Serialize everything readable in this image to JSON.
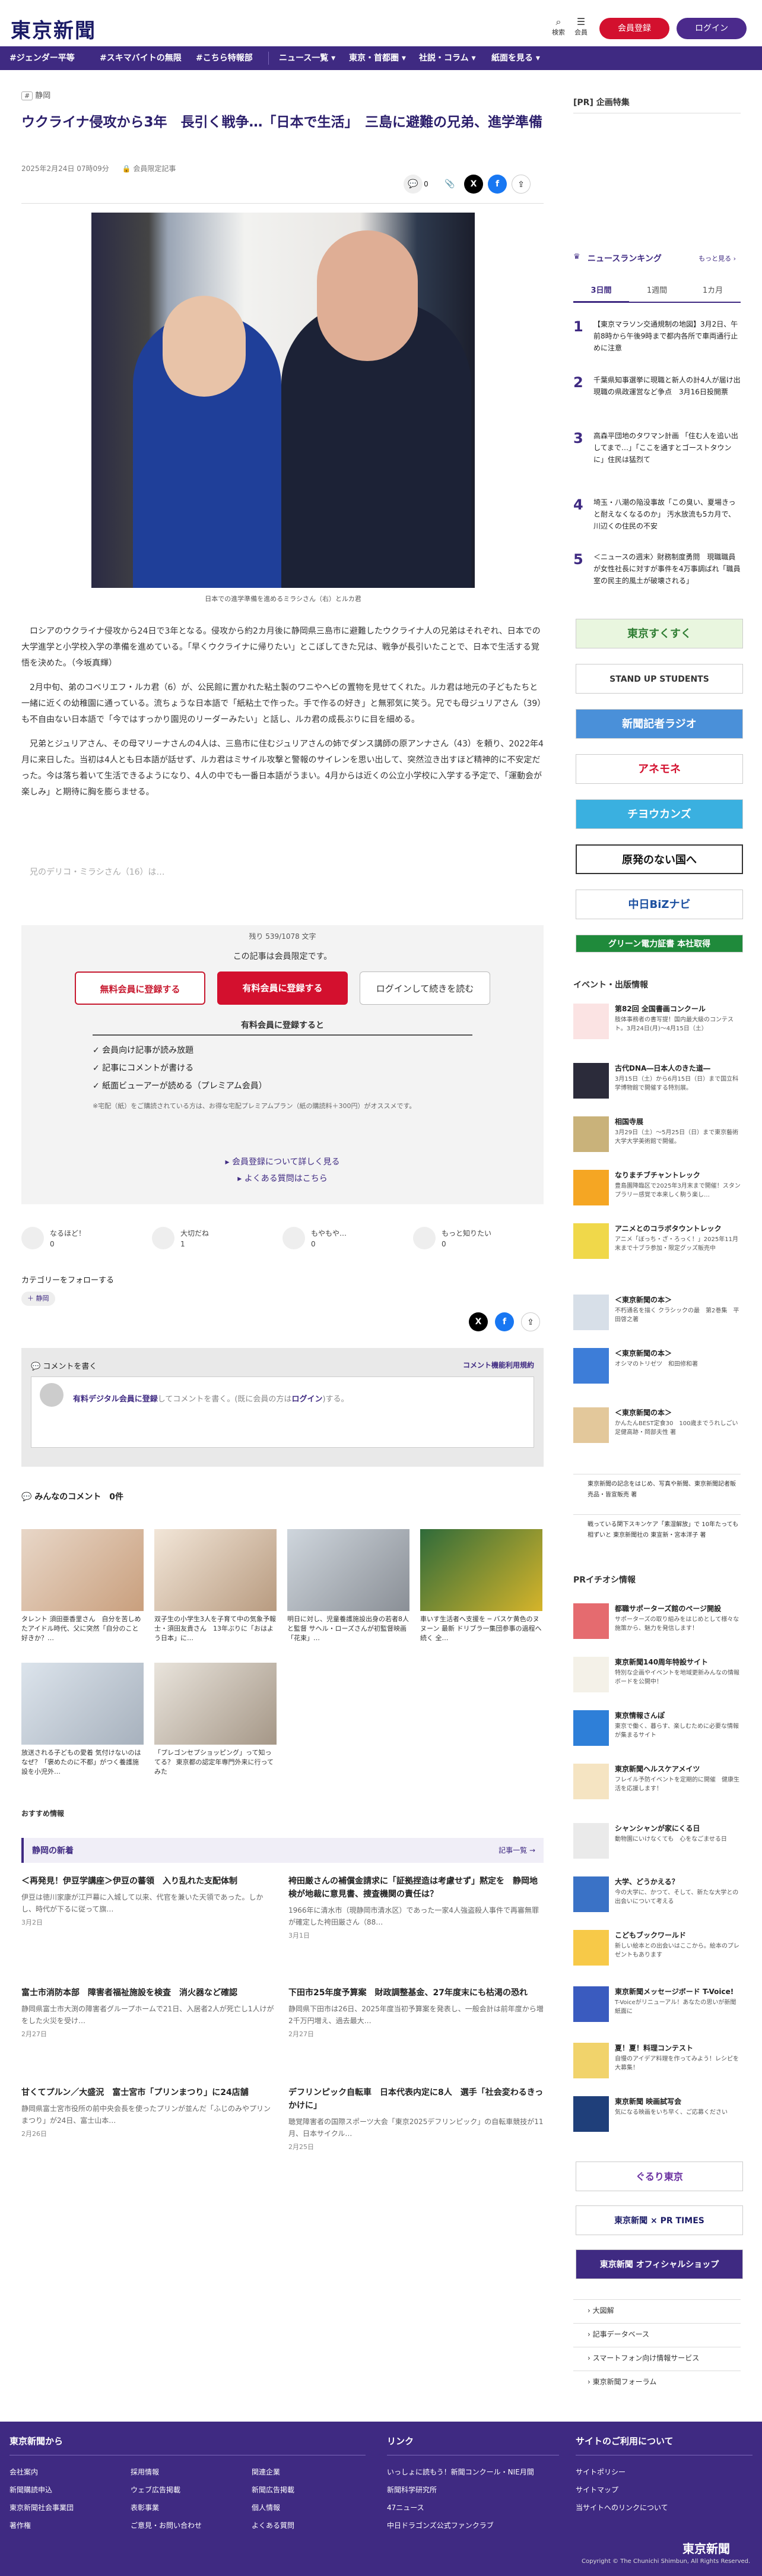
{
  "header": {
    "logo": "東京新聞",
    "search_label": "検索",
    "menu_label": "会員",
    "register_label": "会員登録",
    "login_label": "ログイン"
  },
  "nav": [
    "#ジェンダー平等",
    "#スキマバイトの無限",
    "#こちら特報部",
    "ニュース一覧 ▾",
    "東京・首都圏 ▾",
    "社説・コラム ▾",
    "紙面を見る ▾"
  ],
  "article": {
    "kicker": "静岡",
    "title": "ウクライナ侵攻から3年　長引く戦争…「日本で生活」　三島に避難の兄弟、進学準備",
    "date": "2025年2月24日 07時09分",
    "member_only": "会員限定記事",
    "comment_count": "0",
    "caption": "日本での進学準備を進めるミラシさん（右）とルカ君",
    "paragraphs": [
      "ロシアのウクライナ侵攻から24日で3年となる。侵攻から約2カ月後に静岡県三島市に避難したウクライナ人の兄弟はそれぞれ、日本での大学進学と小学校入学の準備を進めている。「早くウクライナに帰りたい」とこぼしてきた兄は、戦争が長引いたことで、日本で生活する覚悟を決めた。（今坂真輝）",
      "2月中旬、弟のコベリエフ・ルカ君（6）が、公民館に置かれた粘土製のワニやヘビの置物を見せてくれた。ルカ君は地元の子どもたちと一緒に近くの幼稚園に通っている。流ちょうな日本語で「紙粘土で作った。手で作るの好き」と無邪気に笑う。兄でも母ジュリアさん（39）も不自由ない日本語で「今ではすっかり園児のリーダーみたい」と話し、ルカ君の成長ぶりに目を細める。",
      "兄弟とジュリアさん、その母マリーナさんの4人は、三島市に住むジュリアさんの姉でダンス講師の原アンナさん（43）を頼り、2022年4月に来日した。当初は4人とも日本語が話せず、ルカ君はミサイル攻撃と警報のサイレンを思い出して、突然泣き出すほど精神的に不安定だった。今は落ち着いて生活できるようになり、4人の中でも一番日本語がうまい。4月からは近くの公立小学校に入学する予定で、「運動会が楽しみ」と期待に胸を膨らませる。"
    ],
    "fade_text": "兄のデリコ・ミラシさん（16）は…"
  },
  "paywall": {
    "count": "残り 539/1078 文字",
    "only": "この記事は会員限定です。",
    "free_btn": "無料会員に登録する",
    "paid_btn": "有料会員に登録する",
    "login_btn": "ログインして続きを読む",
    "benefit_head": "有料会員に登録すると",
    "benefits": [
      "✓ 会員向け記事が読み放題",
      "✓ 記事にコメントが書ける",
      "✓ 紙面ビューアーが読める（プレミアム会員）"
    ],
    "note": "※宅配（紙）をご購読されている方は、お得な宅配プレミアムプラン（紙の購読料＋300円）がオススメです。",
    "link1": "▸ 会員登録について詳しく見る",
    "link2": "▸ よくある質問はこちら"
  },
  "reactions": [
    {
      "label": "なるほど！",
      "count": "0"
    },
    {
      "label": "大切だね",
      "count": "1"
    },
    {
      "label": "もやもや…",
      "count": "0"
    },
    {
      "label": "もっと知りたい",
      "count": "0"
    }
  ],
  "follow": {
    "label": "カテゴリーをフォローする",
    "chip": "＋ 静岡"
  },
  "comments": {
    "head": "コメントを書く",
    "rules": "コメント機能利用規約",
    "prompt_link": "有料デジタル会員に登録",
    "prompt_text": "してコメントを書く。(既に会員の方は",
    "prompt_login": "ログイン",
    "prompt_end": ")する。",
    "all": "みんなのコメント　0件"
  },
  "recommend": [
    {
      "title": "タレント 須田亜香里さん　自分を苦しめたアイドル時代、父に突然「自分のこと好きか？…"
    },
    {
      "title": "双子生の小学生3人を子育て中の気象予報士・須田友貴さん　13年ぶりに「おはよう日本」に…"
    },
    {
      "title": "明日に対し、児童養護施設出身の若者8人と監督 サヘル・ローズさんが初監督映画「花束」…"
    },
    {
      "title": "車いす生活者へ支援を ─ バスケ黄色のヌヌーン  最新 ドリブラ一集団参事の過程へ続く 全…"
    },
    {
      "title": "放送される子どもの愛着 気付けないのはなぜ？「褒めたのに不都」がつく養護施設を小児外…"
    },
    {
      "title": "「プレゴンセプショッピング」って知ってる？ 東京都の認定年専門外来に行ってみた"
    }
  ],
  "recommend_label": "おすすめ情報",
  "local": {
    "head": "静岡の新着",
    "more": "記事一覧 →",
    "items": [
      {
        "title": "＜再発見！伊豆学講座＞伊豆の蕃領　入り乱れた支配体制",
        "desc": "伊豆は徳川家康が江戸幕に入城して以来、代官を兼いた天領であった。しかし、時代が下るに従って旗…",
        "date": "3月2日"
      },
      {
        "title": "袴田厳さんの補償金請求に「証拠捏造は考慮せず」黙定を　静岡地検が地裁に意見書、捜査機関の責任は？",
        "desc": "1966年に清水市（現静岡市清水区）であった一家4人強盗殺人事件で再審無罪が確定した袴田厳さん（88…",
        "date": "3月1日"
      },
      {
        "title": "富士市消防本部　障害者福祉施設を検査　消火器など確認",
        "desc": "静岡県富士市大渕の障害者グループホームで21日、入居者2人が死亡し1人けがをした火災を受け…",
        "date": "2月27日"
      },
      {
        "title": "下田市25年度予算案　財政調整基金、27年度末にも枯渇の恐れ",
        "desc": "静岡県下田市は26日、2025年度当初予算案を発表し、一般会計は前年度から増2千万円増え、過去最大…",
        "date": "2月27日"
      },
      {
        "title": "甘くてプルン／大盛況　富士宮市「プリンまつり」に24店舗",
        "desc": "静岡県富士宮市役所の前中央会長を使ったプリンが並んだ「ふじのみやプリンまつり」が24日、富士山本…",
        "date": "2月26日"
      },
      {
        "title": "デフリンピック自転車　日本代表内定に8人　選手「社会変わるきっかけに」",
        "desc": "聴覚障害者の国際スポーツ大会「東京2025デフリンピック」の自転車競技が11月、日本サイクル…",
        "date": "2月25日"
      }
    ]
  },
  "sidebar": {
    "pr": "[PR] 企画特集",
    "ranking_head": "ニュースランキング",
    "ranking_more": "もっと見る ›",
    "tabs": [
      "3日間",
      "1週間",
      "1カ月"
    ],
    "ranking": [
      "【東京マラソン交通規制の地図】3月2日、午前8時から午後9時まで都内各所で車両通行止めに注意",
      "千葉県知事選挙に現職と新人の計4人が届け出　現職の県政運営など争点　3月16日投開票",
      "高森平団地のタワマン計画 「住む人を追い出してまで…」「ここを通すとゴーストタウンに」住民は猛烈て",
      "埼玉・八潮の陥没事故「この臭い、夏場きっと耐えなくなるのか」 汚水放流も5カ月で、川辺くの住民の不安",
      "＜ニュースの週末〉財務制度勇問　現職職員が女性社長に対すが事件を4万事調ばれ「職員室の民主的風土が破壊される」"
    ],
    "banners": [
      "東京すくすく",
      "STAND UP STUDENTS",
      "新聞記者ラジオ",
      "アネモネ",
      "チヨウカンズ",
      "原発のない国へ",
      "中日BiZナビ",
      "グリーン電力証書 本社取得"
    ],
    "events_head": "イベント・出版情報",
    "events": [
      {
        "title": "第82回 全国書画コンクール",
        "desc": "肢体事務者の書写提！国内最大級のコンテスト。3月24日(月)～4月15日（土）"
      },
      {
        "title": "古代DNA―日本人のきた道―",
        "desc": "3月15日（土）から6月15日（日）まで国立科学博物館で開催する特別展。"
      },
      {
        "title": "相国寺展",
        "desc": "3月29日（土）～5月25日（日）まで東京藝術大学大学美術館で開催。"
      },
      {
        "title": "なりまチブチャントレック",
        "desc": "豊島園降臨区で2025年3月末まで開催！スタンプラリー感覚で本来しく駒う楽し…"
      },
      {
        "title": "アニメとのコラボタウントレック",
        "desc": "アニメ「ぼっち・ざ・ろっく！」2025年11月末まで十ブラ参加・限定グッズ販売中"
      },
      {
        "title": "＜東京新聞の本＞",
        "desc": "不朽通名を描く クラシックの最　第2巻集　平田啓之著"
      },
      {
        "title": "＜東京新聞の本＞",
        "desc": "オシマのトリゼツ　和田修和著"
      },
      {
        "title": "＜東京新聞の本＞",
        "desc": "かんたんBEST定食30　100歳までうれしごい　足健高跡・岡部夫性 著"
      }
    ],
    "extra1": "東京新聞の記念をはじめ、写真や新聞、東京新聞記者販売品・皆宣販売 著",
    "extra2": "戦っている関下スキンケア「素湿解放」で 10年たっても相ずいと 東京新聞社の 東宣新・宮本洋子 著",
    "pr_head": "PRイチオシ情報",
    "pr_items": [
      {
        "title": "都職サポーターズ館のページ開設",
        "desc": "サポーターズの取り組みをはじめとして様々な施策から、魅力を発信します！"
      },
      {
        "title": "東京新聞140周年特設サイト",
        "desc": "特別な企画やイベントを地域更新みんなの情報ボードを公開中！"
      },
      {
        "title": "東京情報さんぽ",
        "desc": "東京で働く、暮らす、楽しむために必要な情報が集まるサイト"
      },
      {
        "title": "東京新聞ヘルスケアメイツ",
        "desc": "フレイル予防イベントを定期的に開催　健康生活を応援します！"
      },
      {
        "title": "シャンシャンが家にくる日",
        "desc": "動物園にいけなくても　心をなごませる日"
      },
      {
        "title": "大学、どうかえる？",
        "desc": "今の大学に、かつて、そして、新たな大学との出会いについて考える"
      },
      {
        "title": "こどもブックワールド",
        "desc": "新しい絵本との出会いはここから。絵本のプレゼントもあります"
      },
      {
        "title": "東京新聞メッセージボード T-Voice!",
        "desc": "T-Voiceがリニューアル！あなたの思いが新聞紙面に"
      },
      {
        "title": "夏！夏！料理コンテスト",
        "desc": "自慢のアイデア料理を作ってみよう！レシピを大募集！"
      },
      {
        "title": "東京新聞 映画試写会",
        "desc": "気になる映画をいち早く、ご応募ください"
      }
    ],
    "list": [
      "大図解",
      "記事データベース",
      "スマートフォン向け情報サービス",
      "東京新聞フォーラム"
    ]
  },
  "footer": {
    "col1_head": "東京新聞から",
    "col2_head": "リンク",
    "col3_head": "サイトのご利用について",
    "col1": [
      "会社案内",
      "新聞購読申込",
      "東京新聞社会事業団",
      "著作権",
      "採用情報",
      "ウェブ広告掲載",
      "表彰事業",
      "ご意見・お問い合わせ",
      "関連企業",
      "新聞広告掲載",
      "個人情報",
      "よくある質問"
    ],
    "col2": [
      "いっしょに読もう！新聞コンクール・NIE月間",
      "新聞科学研究所",
      "47ニュース",
      "中日ドラゴンズ公式ファンクラブ"
    ],
    "col3": [
      "サイトポリシー",
      "サイトマップ",
      "当サイトへのリンクについて"
    ],
    "logo": "東京新聞",
    "copy": "Copyright © The Chunichi Shimbun, All Rights Reserved."
  },
  "colors": {
    "brand": "#3f2a82",
    "accent": "#d3102e"
  }
}
